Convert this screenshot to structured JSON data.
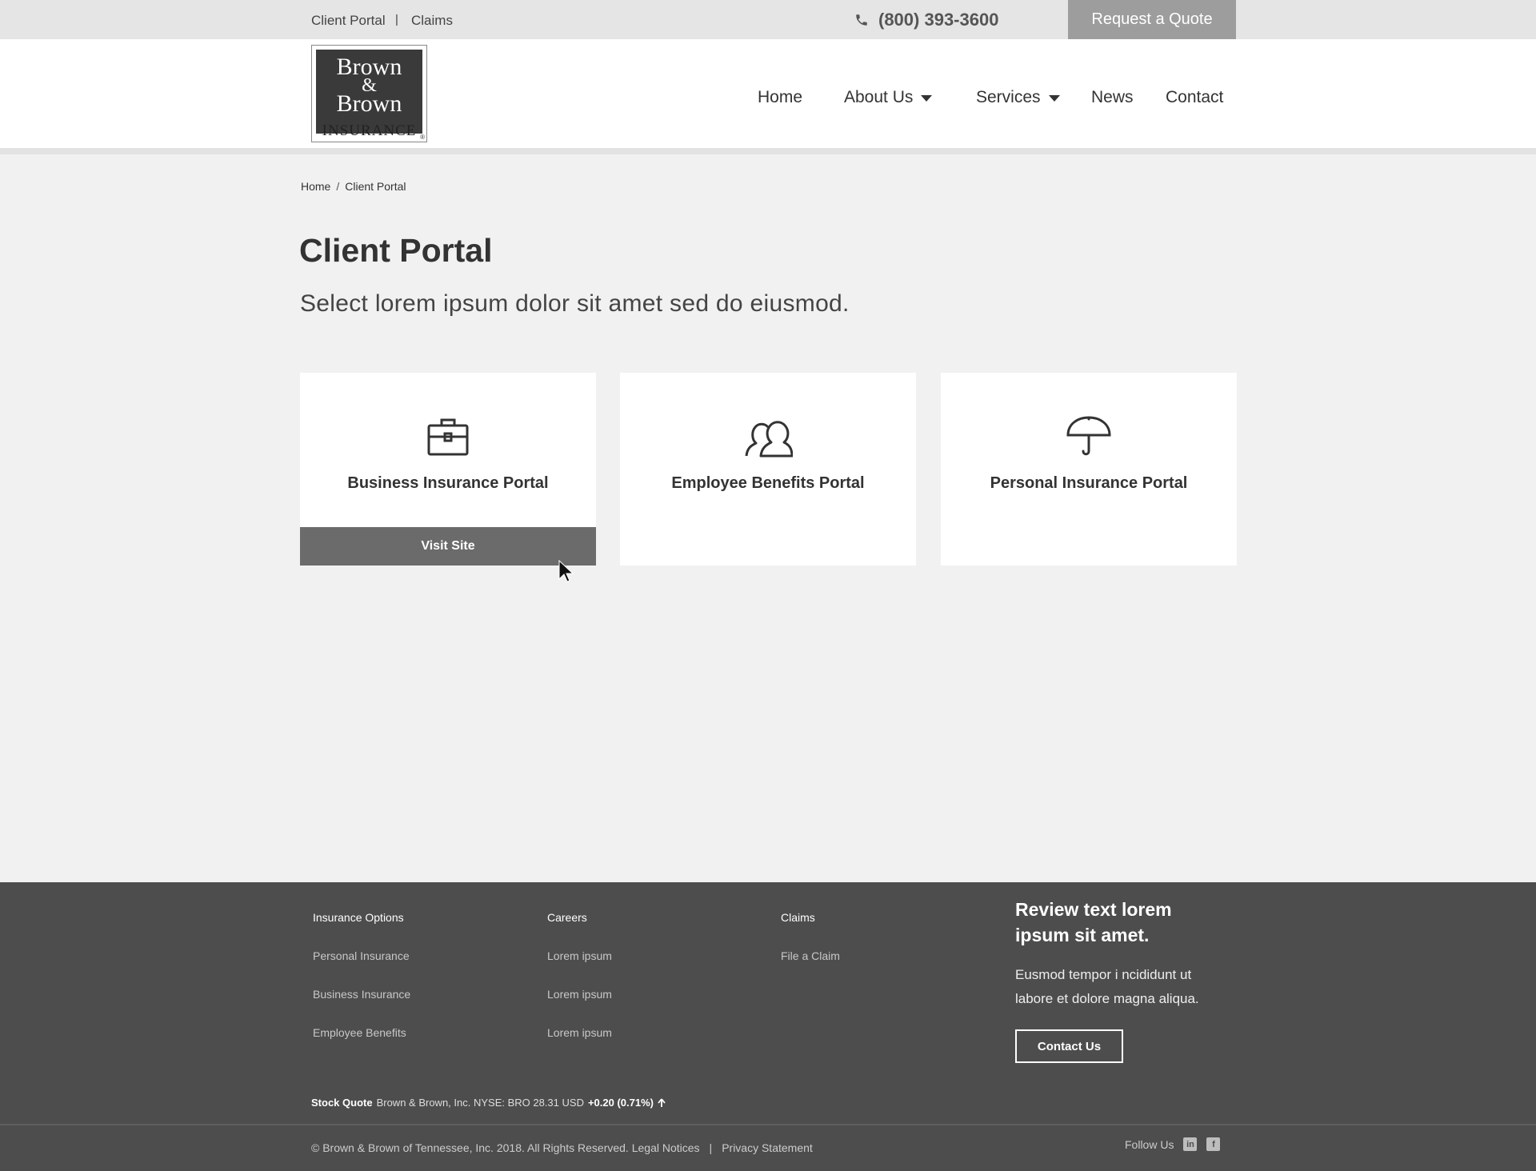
{
  "topbar": {
    "client_portal": "Client Portal",
    "separator": "|",
    "claims": "Claims",
    "phone": "(800) 393-3600",
    "quote_button": "Request a Quote"
  },
  "logo": {
    "line1": "Brown",
    "amp": "&",
    "line2": "Brown",
    "insurance": "INSURANCE"
  },
  "nav": {
    "home": "Home",
    "about": "About Us",
    "services": "Services",
    "news": "News",
    "contact": "Contact"
  },
  "breadcrumb": {
    "home": "Home",
    "sep": "/",
    "current": "Client Portal"
  },
  "page": {
    "title": "Client Portal",
    "subtitle": "Select lorem ipsum dolor sit amet sed do eiusmod."
  },
  "cards": [
    {
      "title": "Business Insurance Portal",
      "icon": "briefcase-icon",
      "button": "Visit Site"
    },
    {
      "title": "Employee Benefits Portal",
      "icon": "people-icon"
    },
    {
      "title": "Personal Insurance Portal",
      "icon": "umbrella-icon"
    }
  ],
  "footer": {
    "col1": {
      "heading": "Insurance Options",
      "links": [
        "Personal Insurance",
        "Business Insurance",
        "Employee Benefits"
      ]
    },
    "col2": {
      "heading": "Careers",
      "links": [
        "Lorem ipsum",
        "Lorem ipsum",
        "Lorem ipsum"
      ]
    },
    "col3": {
      "heading": "Claims",
      "links": [
        "File a Claim"
      ]
    },
    "review": {
      "title": "Review text lorem ipsum sit amet.",
      "text": "Eusmod tempor i ncididunt ut labore et dolore magna aliqua.",
      "button": "Contact Us"
    },
    "stock": {
      "label": "Stock Quote",
      "text": "Brown & Brown, Inc. NYSE: BRO 28.31 USD",
      "change": "+0.20 (0.71%)"
    },
    "copyright": "© Brown & Brown of Tennessee, Inc. 2018. All Rights Reserved.",
    "legal": "Legal Notices",
    "sep": "|",
    "privacy": "Privacy Statement",
    "follow": "Follow Us"
  }
}
